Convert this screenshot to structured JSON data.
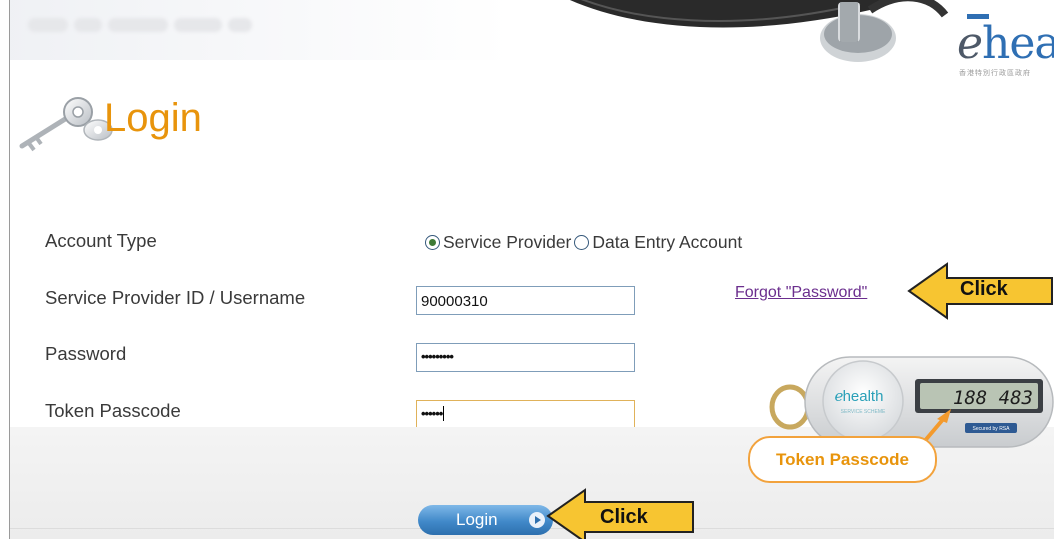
{
  "header": {
    "logo_text": "ehea",
    "logo_subtitle": "香港特別行政區政府"
  },
  "login": {
    "title": "Login"
  },
  "form": {
    "account_type_label": "Account Type",
    "account_type_options": [
      {
        "label": "Service Provider",
        "selected": true
      },
      {
        "label": "Data Entry Account",
        "selected": false
      }
    ],
    "username_label": "Service Provider ID / Username",
    "username_value": "90000310",
    "password_label": "Password",
    "password_value": "•••••••••",
    "token_label": "Token Passcode",
    "token_value": "••••••",
    "forgot_link": "Forgot \"Password\"",
    "login_button": "Login"
  },
  "annotations": {
    "click_forgot": "Click",
    "click_login": "Click",
    "token_passcode_callout": "Token Passcode"
  },
  "token_device": {
    "brand": "health",
    "display": "188 483",
    "footer": "Secured by RSA"
  },
  "colors": {
    "accent_orange": "#e8940c",
    "link_purple": "#6b2e8e",
    "button_blue": "#4189c9",
    "callout_yellow": "#f7c531"
  }
}
